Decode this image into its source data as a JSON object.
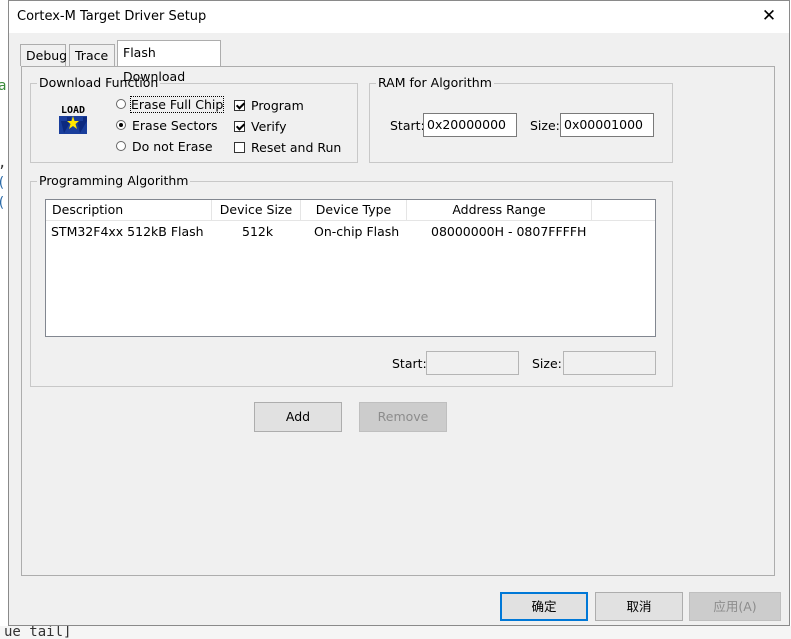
{
  "window": {
    "title": "Cortex-M Target Driver Setup",
    "close_glyph": "✕"
  },
  "tabs": [
    {
      "label": "Debug",
      "active": false
    },
    {
      "label": "Trace",
      "active": false
    },
    {
      "label": "Flash Download",
      "active": true
    }
  ],
  "download_function": {
    "group_label": "Download Function",
    "icon": "load-icon",
    "icon_text": "LOAD",
    "erase_options": [
      {
        "label": "Erase Full Chip",
        "selected": false
      },
      {
        "label": "Erase Sectors",
        "selected": true
      },
      {
        "label": "Do not Erase",
        "selected": false
      }
    ],
    "checkboxes": [
      {
        "label": "Program",
        "checked": true
      },
      {
        "label": "Verify",
        "checked": true
      },
      {
        "label": "Reset and Run",
        "checked": false
      }
    ]
  },
  "ram": {
    "group_label": "RAM for Algorithm",
    "start_label": "Start:",
    "start_value": "0x20000000",
    "size_label": "Size:",
    "size_value": "0x00001000"
  },
  "programming_algorithm": {
    "group_label": "Programming Algorithm",
    "columns": [
      "Description",
      "Device Size",
      "Device Type",
      "Address Range"
    ],
    "rows": [
      {
        "description": "STM32F4xx 512kB Flash",
        "device_size": "512k",
        "device_type": "On-chip Flash",
        "address_range": "08000000H - 0807FFFFH"
      }
    ],
    "start_label": "Start:",
    "start_value": "",
    "size_label": "Size:",
    "size_value": ""
  },
  "buttons": {
    "add": "Add",
    "remove": "Remove",
    "ok": "确定",
    "cancel": "取消",
    "apply": "应用(A)"
  },
  "background_text": {
    "bottom_line": "ue  tail]"
  }
}
